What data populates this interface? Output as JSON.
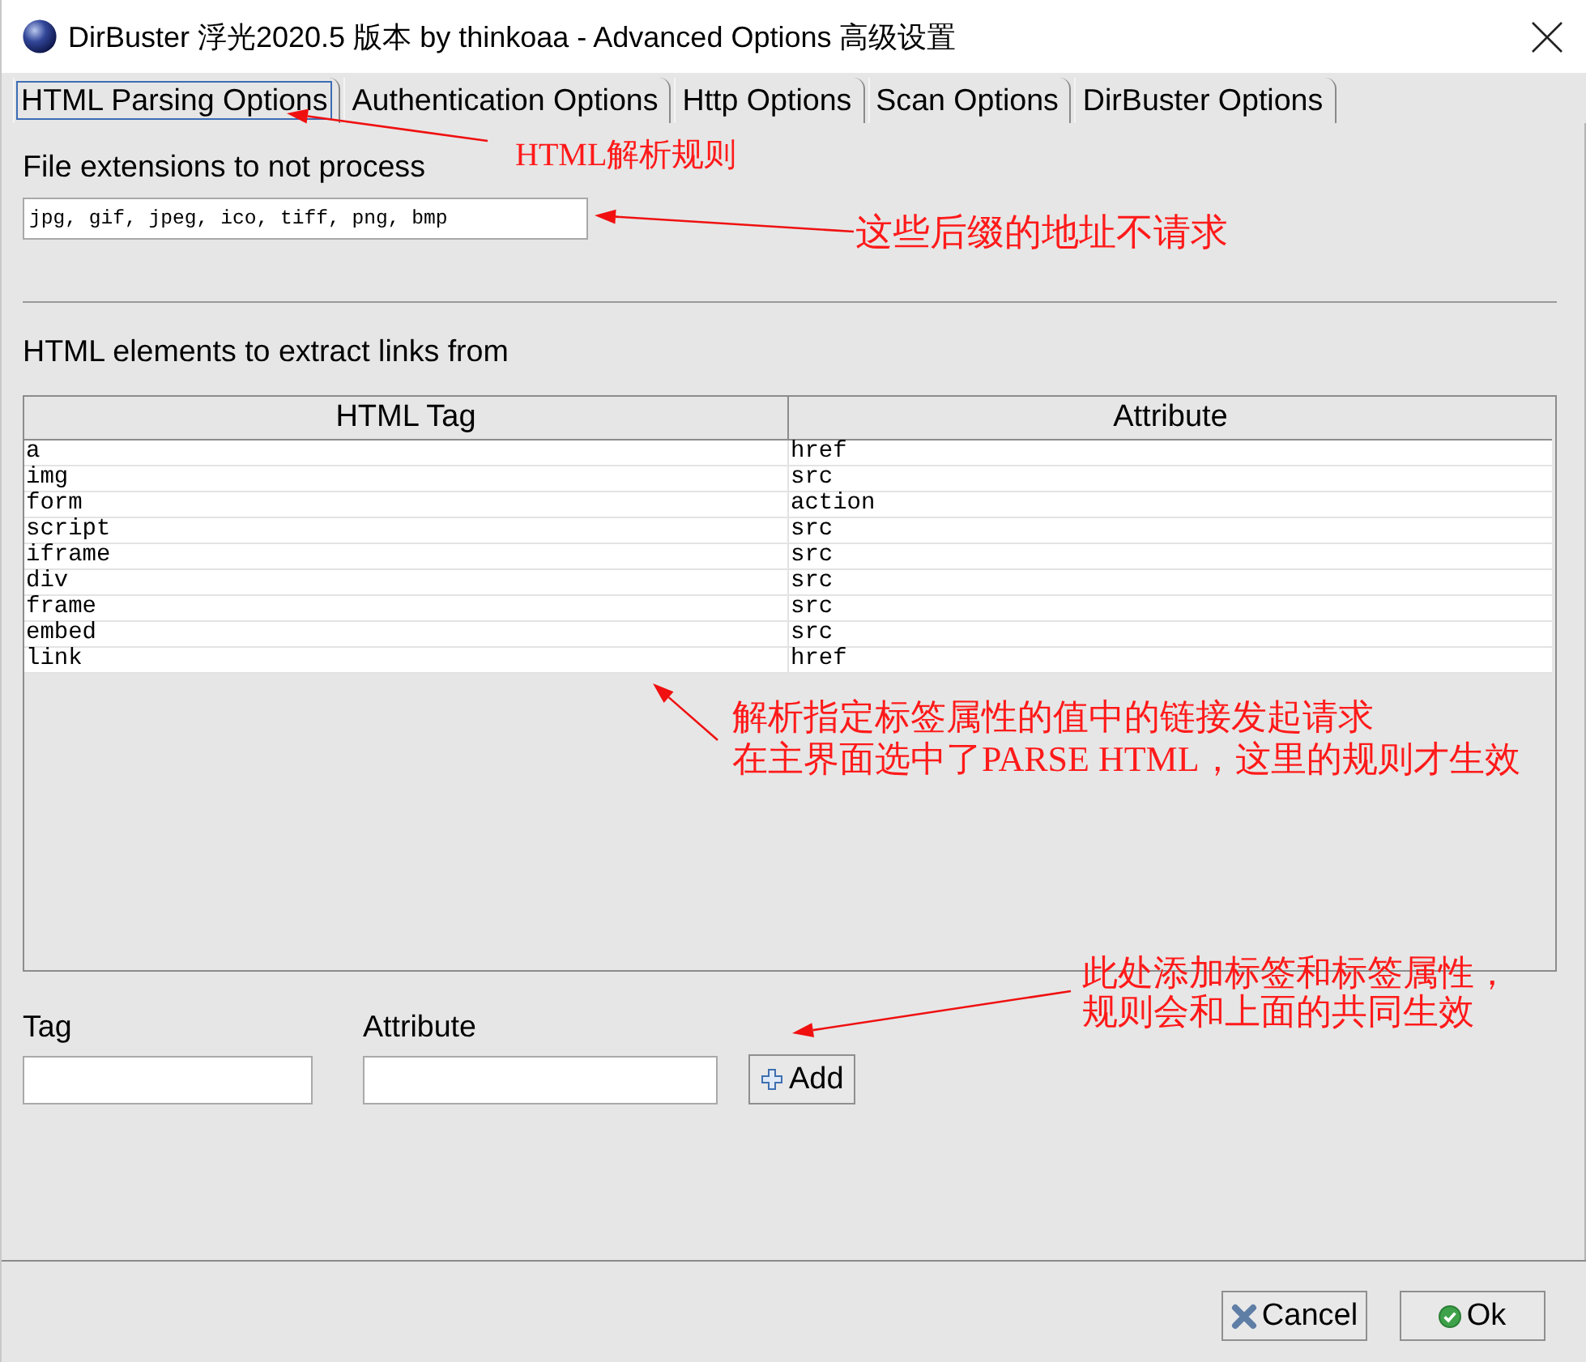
{
  "window": {
    "title": "DirBuster 浮光2020.5 版本 by thinkoaa - Advanced Options 高级设置"
  },
  "tabs": [
    {
      "label": "HTML Parsing Options",
      "selected": true
    },
    {
      "label": "Authentication Options",
      "selected": false
    },
    {
      "label": "Http Options",
      "selected": false
    },
    {
      "label": "Scan Options",
      "selected": false
    },
    {
      "label": "DirBuster Options",
      "selected": false
    }
  ],
  "html_parsing": {
    "extensions_label": "File extensions to not process",
    "extensions_field": {
      "value": "jpg, gif, jpeg, ico, tiff, png, bmp"
    },
    "elements_label": "HTML elements to extract links from",
    "table": {
      "columns": [
        "HTML Tag",
        "Attribute"
      ],
      "rows": [
        [
          "a",
          "href"
        ],
        [
          "img",
          "src"
        ],
        [
          "form",
          "action"
        ],
        [
          "script",
          "src"
        ],
        [
          "iframe",
          "src"
        ],
        [
          "div",
          "src"
        ],
        [
          "frame",
          "src"
        ],
        [
          "embed",
          "src"
        ],
        [
          "link",
          "href"
        ]
      ]
    },
    "tag_field": {
      "label": "Tag"
    },
    "attribute_field": {
      "label": "Attribute"
    },
    "add_button": {
      "label": "Add"
    }
  },
  "buttons": [
    {
      "kind": "cancel",
      "label": "Cancel"
    },
    {
      "kind": "ok",
      "label": "Ok"
    }
  ],
  "annotations": [
    {
      "lines": [
        "HTML解析规则"
      ]
    },
    {
      "lines": [
        "这些后缀的地址不请求"
      ]
    },
    {
      "lines": [
        "解析指定标签属性的值中的链接发起请求",
        "在主界面选中了PARSE HTML，这里的规则才生效"
      ]
    },
    {
      "lines": [
        "此处添加标签和标签属性，",
        "规则会和上面的共同生效"
      ]
    }
  ]
}
